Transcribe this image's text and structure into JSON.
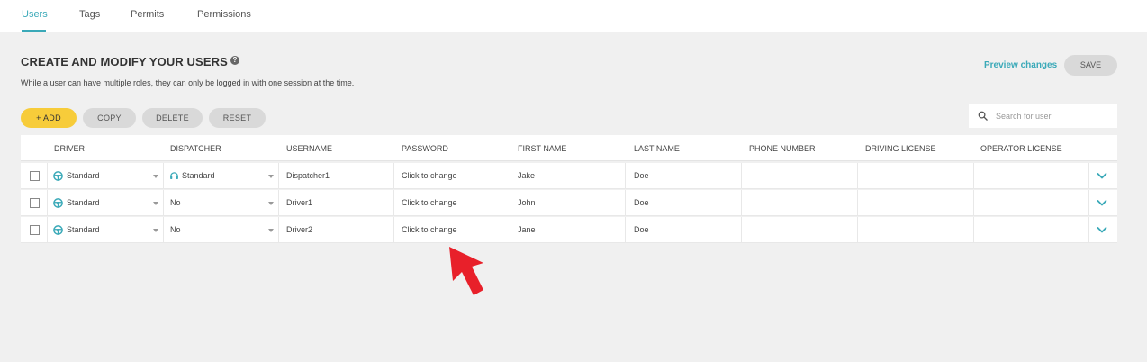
{
  "nav": {
    "tabs": [
      {
        "label": "Users",
        "active": true
      },
      {
        "label": "Tags",
        "active": false
      },
      {
        "label": "Permits",
        "active": false
      },
      {
        "label": "Permissions",
        "active": false
      }
    ]
  },
  "header": {
    "title": "CREATE AND MODIFY YOUR USERS",
    "help_icon": "?",
    "subtitle": "While a user can have multiple roles, they can only be logged in with one session at the time.",
    "preview_label": "Preview changes",
    "save_label": "SAVE"
  },
  "toolbar": {
    "add_label": "+ ADD",
    "copy_label": "COPY",
    "delete_label": "DELETE",
    "reset_label": "RESET",
    "search_placeholder": "Search for user"
  },
  "table": {
    "columns": [
      "DRIVER",
      "DISPATCHER",
      "USERNAME",
      "PASSWORD",
      "FIRST NAME",
      "LAST NAME",
      "PHONE NUMBER",
      "DRIVING LICENSE",
      "OPERATOR LICENSE"
    ],
    "rows": [
      {
        "driver": "Standard",
        "dispatcher": "Standard",
        "username": "Dispatcher1",
        "password": "Click to change",
        "first_name": "Jake",
        "last_name": "Doe",
        "phone": "",
        "driving_license": "",
        "operator_license": ""
      },
      {
        "driver": "Standard",
        "dispatcher": "No",
        "username": "Driver1",
        "password": "Click to change",
        "first_name": "John",
        "last_name": "Doe",
        "phone": "",
        "driving_license": "",
        "operator_license": ""
      },
      {
        "driver": "Standard",
        "dispatcher": "No",
        "username": "Driver2",
        "password": "Click to change",
        "first_name": "Jane",
        "last_name": "Doe",
        "phone": "",
        "driving_license": "",
        "operator_license": ""
      }
    ]
  },
  "colors": {
    "accent": "#3aa9b8",
    "add_button": "#f7cc3a",
    "annotation_arrow": "#e8202a"
  },
  "icons": [
    "help-icon",
    "search-icon",
    "steering-wheel-icon",
    "headset-icon",
    "dropdown-caret-icon",
    "chevron-down-icon",
    "annotation-arrow-icon"
  ]
}
